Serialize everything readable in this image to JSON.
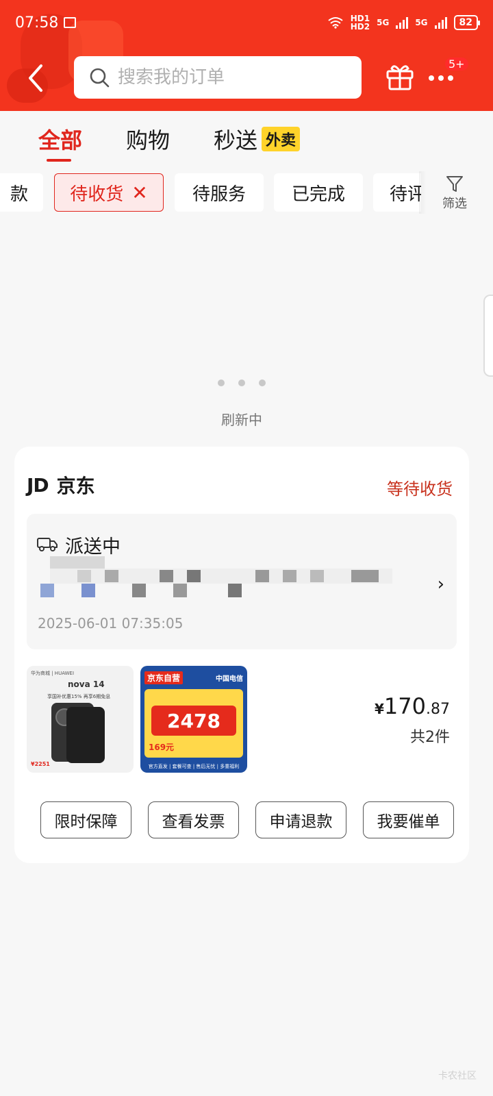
{
  "status_bar": {
    "time": "07:58",
    "net_label_1": "HD1",
    "net_label_2": "HD2",
    "sig1": "5G",
    "sig2": "5G",
    "battery": "82"
  },
  "header": {
    "search_placeholder": "搜索我的订单",
    "more_badge": "5+",
    "colors": {
      "bg": "#f3341e"
    }
  },
  "tabs": [
    {
      "label": "全部"
    },
    {
      "label": "购物"
    },
    {
      "label": "秒送",
      "badge": "外卖"
    }
  ],
  "chips": [
    {
      "label": "款"
    },
    {
      "label": "待收货"
    },
    {
      "label": "待服务"
    },
    {
      "label": "已完成"
    },
    {
      "label": "待评"
    }
  ],
  "filter_label": "筛选",
  "loading_text": "刷新中",
  "order": {
    "shop_logo": "JD",
    "shop_name": "京东",
    "status": "等待收货",
    "delivery_title": "派送中",
    "delivery_time": "2025-06-01 07:35:05",
    "product1": {
      "brand": "华为商城 | HUAWEI",
      "model": "nova 14",
      "promo": "享国补优惠15% 再享6期免息",
      "price": "¥2251"
    },
    "product2": {
      "self_tag": "京东自营",
      "carrier": "中国电信",
      "amount": "2478",
      "small": "169元",
      "footer": "官方直发 | 套餐可查 | 售后无忧 | 多重福利"
    },
    "price_yen": "¥",
    "price_int": "170",
    "price_dec": ".87",
    "count": "共2件",
    "buttons": [
      "限时保障",
      "查看发票",
      "申请退款",
      "我要催单"
    ]
  },
  "watermark": "卡农社区"
}
